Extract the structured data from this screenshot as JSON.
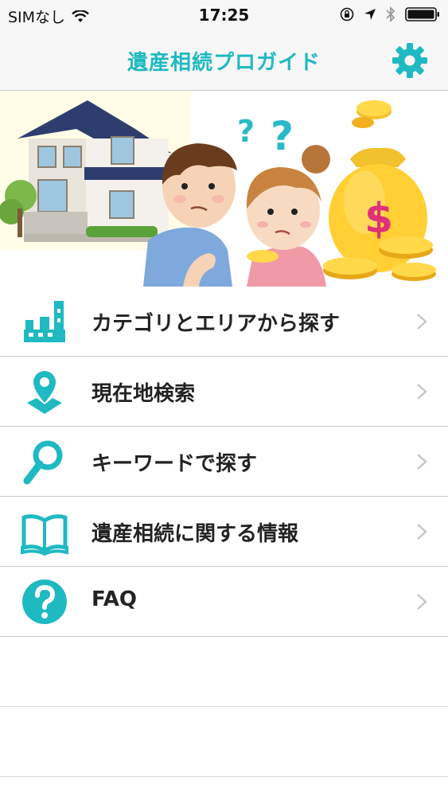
{
  "status_bar": {
    "carrier": "SIMなし",
    "time": "17:25"
  },
  "nav": {
    "title": "遺産相続プロガイド",
    "settings_icon": "gear-icon"
  },
  "colors": {
    "accent": "#1fb9c2",
    "separator": "#c8c8c8",
    "chevron": "#c7c7cc"
  },
  "menu": {
    "items": [
      {
        "label": "カテゴリとエリアから探す",
        "icon": "city-buildings-icon"
      },
      {
        "label": "現在地検索",
        "icon": "location-pin-icon"
      },
      {
        "label": "キーワードで探す",
        "icon": "magnifier-icon"
      },
      {
        "label": "遺産相続に関する情報",
        "icon": "open-book-icon"
      },
      {
        "label": "FAQ",
        "icon": "question-circle-icon"
      }
    ]
  }
}
